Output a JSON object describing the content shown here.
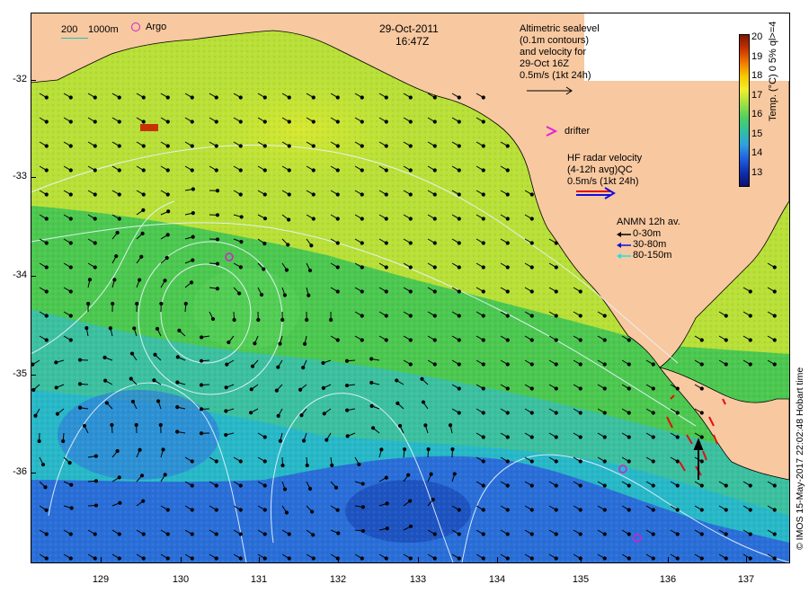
{
  "header": {
    "date": "29-Oct-2011",
    "time": "16:47Z"
  },
  "scale_bar": {
    "label_200": "200",
    "label_1000": "1000m",
    "argo_label": "Argo"
  },
  "altimetry": {
    "lines": [
      "Altimetric sealevel",
      "(0.1m contours)",
      "and velocity for",
      "29-Oct 16Z",
      "0.5m/s (1kt 24h)"
    ]
  },
  "drifter": {
    "label": "drifter"
  },
  "hf_radar": {
    "lines": [
      "HF radar velocity",
      "(4-12h avg)QC",
      "0.5m/s (1kt 24h)"
    ]
  },
  "anmn": {
    "title": "ANMN 12h av.",
    "items": [
      {
        "label": "0-30m",
        "color": "#000000"
      },
      {
        "label": "30-80m",
        "color": "#1010e0"
      },
      {
        "label": "80-150m",
        "color": "#20e0e0"
      }
    ]
  },
  "colorbar": {
    "title": "Temp. (°C) 0 5% ql>=4",
    "ticks": [
      "20",
      "19",
      "18",
      "17",
      "16",
      "15",
      "14",
      "13"
    ],
    "colors": [
      "#7a1a00",
      "#c83200",
      "#f07800",
      "#f8c800",
      "#f0f030",
      "#a0e040",
      "#50d060",
      "#30c0a0",
      "#30a0e0",
      "#2060e0",
      "#1030b0",
      "#0a1070"
    ]
  },
  "axes": {
    "y_ticks": [
      "-32",
      "-33",
      "-34",
      "-35",
      "-36"
    ],
    "x_ticks": [
      "129",
      "130",
      "131",
      "132",
      "133",
      "134",
      "135",
      "136",
      "137"
    ]
  },
  "credit": "© IMOS 15-May-2017 22:02:48 Hobart time",
  "map": {
    "land_color": "#f8c8a0",
    "sst_warm": "#b8e038",
    "sst_mid": "#4cc850",
    "sst_cool": "#28b8c8",
    "sst_cold": "#2a6ed8",
    "argo_color": "#d020d0",
    "drifter_color": "#e020e0",
    "radar_color": "#e01010"
  }
}
